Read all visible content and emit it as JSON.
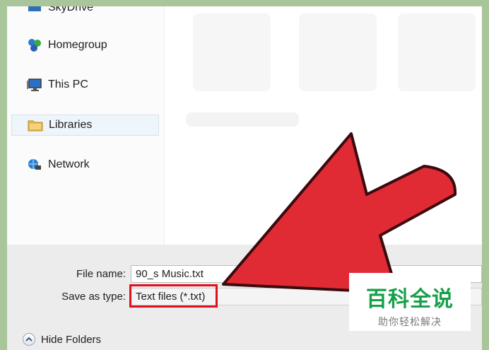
{
  "nav": {
    "items": [
      {
        "label": "SkyDrive",
        "icon": "skydrive-icon"
      },
      {
        "label": "Homegroup",
        "icon": "homegroup-icon"
      },
      {
        "label": "This PC",
        "icon": "computer-icon"
      },
      {
        "label": "Libraries",
        "icon": "libraries-folder-icon",
        "selected": true
      },
      {
        "label": "Network",
        "icon": "network-icon"
      }
    ]
  },
  "form": {
    "file_name_label": "File name:",
    "file_name_value": "90_s Music.txt",
    "save_type_label": "Save as type:",
    "save_type_value": "Text files (*.txt)"
  },
  "footer": {
    "hide_folders_label": "Hide Folders"
  },
  "annotation": {
    "arrow_color": "#e02a34",
    "highlight_color": "#e0101c"
  },
  "watermark": {
    "title": "百科全说",
    "subtitle": "助你轻松解决"
  }
}
